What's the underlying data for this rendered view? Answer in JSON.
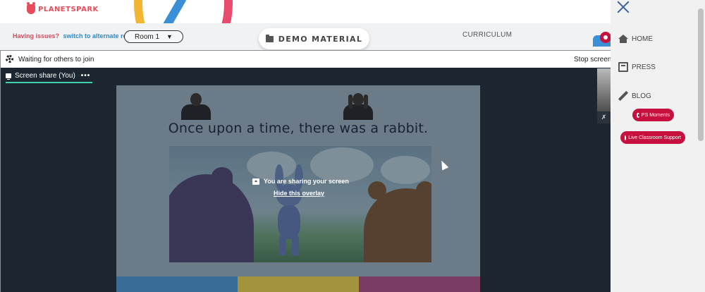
{
  "header": {
    "logo_text": "PLANETSPARK"
  },
  "classbar": {
    "issue_label": "Having issues?",
    "alternate_link": "switch to alternate room",
    "room_select": {
      "value": "Room 1"
    },
    "demo_material_label": "DEMO MATERIAL",
    "curriculum_label": "CURRICULUM"
  },
  "meeting": {
    "waiting_text": "Waiting for others to join",
    "stop_share_text": "Stop screen",
    "share_tab_label": "Screen share (You)",
    "share_tab_more": "•••",
    "sharing_message": "You are sharing your screen",
    "hide_overlay_link": "Hide this overlay"
  },
  "slide": {
    "sentence": "Once upon a time, there was a rabbit."
  },
  "sidenav": {
    "items": [
      {
        "label": "HOME",
        "icon": "home-icon"
      },
      {
        "label": "PRESS",
        "icon": "newspaper-icon"
      },
      {
        "label": "BLOG",
        "icon": "pencil-icon"
      }
    ],
    "ps_moments_label": "PS Moments",
    "live_support_label": "Live Classroom Support"
  },
  "colors": {
    "brand_red": "#c8103e",
    "link_blue": "#2f8bc9",
    "issue_red": "#d84a5f",
    "share_tab_accent": "#3fd1a8",
    "meeting_bg": "#1b2630"
  }
}
